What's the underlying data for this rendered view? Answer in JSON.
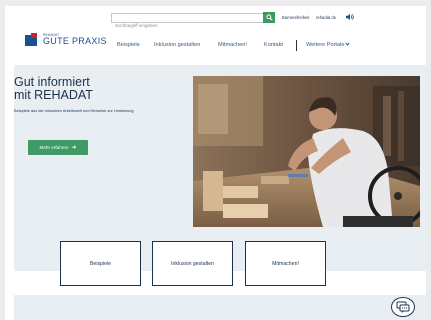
{
  "header": {
    "search": {
      "placeholder": "Suchbegriff eingeben",
      "value": ""
    },
    "search_icon": "search-icon",
    "util_accessibility": "Barrierefreiheit",
    "util_separator": "·",
    "util_portal": "rehadat.de",
    "speaker_icon": "speaker-icon",
    "logo": {
      "small": "REHADAT",
      "big": "GUTE PRAXIS"
    }
  },
  "nav": {
    "items": [
      "Beispiele",
      "Inklusion gestalten",
      "Mitmachen!",
      "Kontakt"
    ],
    "more": "Weitere Portale"
  },
  "hero": {
    "title_line1": "Gut informiert",
    "title_line2": "mit REHADAT",
    "subtitle": "Beispiele aus der inklusiven Arbeitswelt und Hinweise zur Umsetzung",
    "cta": "Mehr erfahren",
    "cta_icon": "arrow-right-icon",
    "photo_alt": "person-at-workbench-photo"
  },
  "tiles": [
    "Beispiele",
    "Inklusion gestalten",
    "Mitmachen!"
  ],
  "chat_icon": "chat-icon",
  "colors": {
    "brand_blue": "#1b4f8f",
    "brand_red": "#c8262d",
    "green": "#3f9b65",
    "navy": "#1d3149",
    "hero_bg": "#e9eef3"
  }
}
